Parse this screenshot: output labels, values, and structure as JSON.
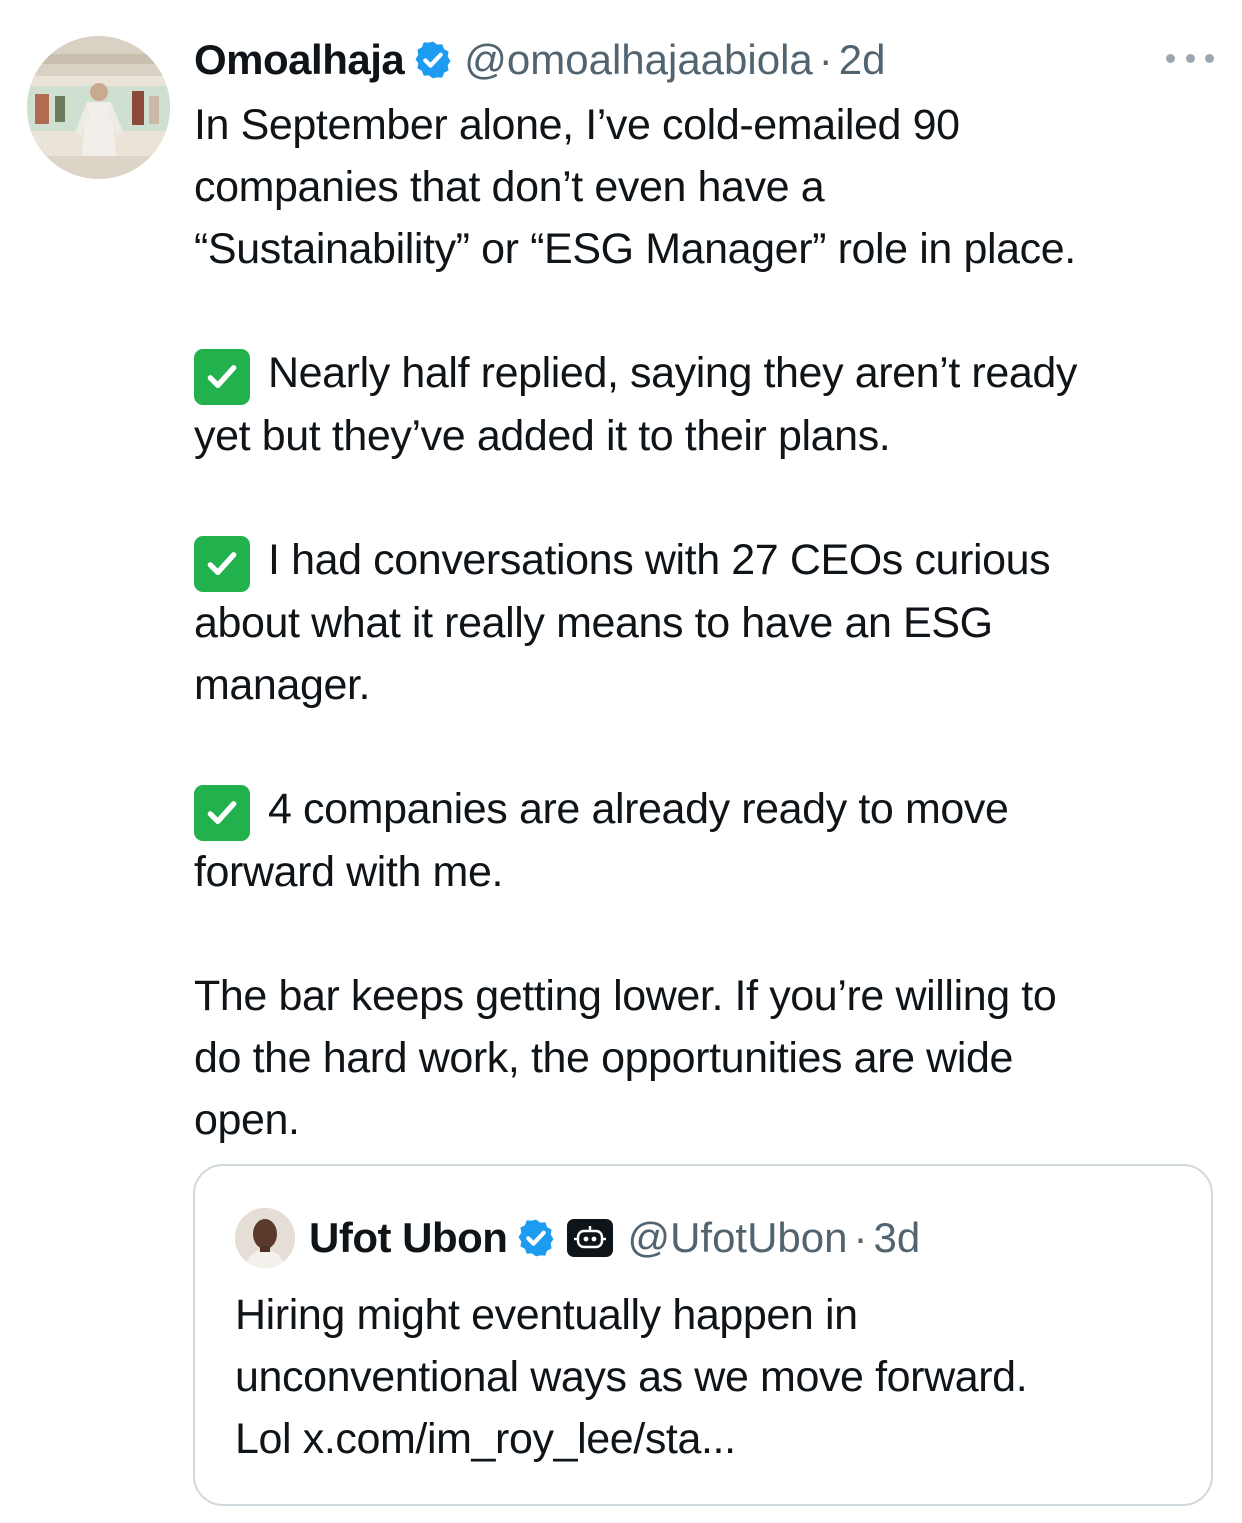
{
  "tweet": {
    "author_name": "Omoalhaja",
    "handle": "@omoalhajaabiola",
    "separator": "·",
    "time": "2d",
    "paragraphs": [
      {
        "has_check": false,
        "lines": [
          "In September alone, I’ve cold-emailed 90",
          "companies that don’t even have a",
          "“Sustainability” or “ESG Manager” role in place."
        ]
      },
      {
        "has_check": true,
        "lines": [
          "Nearly half replied, saying they aren’t ready",
          "yet but they’ve added it to their plans."
        ]
      },
      {
        "has_check": true,
        "lines": [
          "I had conversations with 27 CEOs curious",
          "about what it really means to have an ESG",
          "manager."
        ]
      },
      {
        "has_check": true,
        "lines": [
          "4 companies are already ready to move",
          "forward with me."
        ]
      },
      {
        "has_check": false,
        "lines": [
          "The bar keeps getting lower. If you’re willing to",
          "do the hard work, the opportunities are wide",
          "open."
        ]
      }
    ]
  },
  "quoted_tweet": {
    "author_name": "Ufot Ubon",
    "handle": "@UfotUbon",
    "separator": "·",
    "time": "3d",
    "lines": [
      "Hiring might eventually happen in",
      "unconventional ways as we move forward.",
      "Lol x.com/im_roy_lee/sta..."
    ]
  },
  "colors": {
    "text": "#0f1419",
    "secondary_text": "#536471",
    "verified_blue": "#1d9bf0",
    "check_green": "#22b14c",
    "border": "#cfd9de"
  },
  "icons": {
    "verified": "verified-badge-icon",
    "more": "more-options-icon",
    "check": "check-mark-button-icon",
    "affiliate": "robot-badge-icon"
  }
}
